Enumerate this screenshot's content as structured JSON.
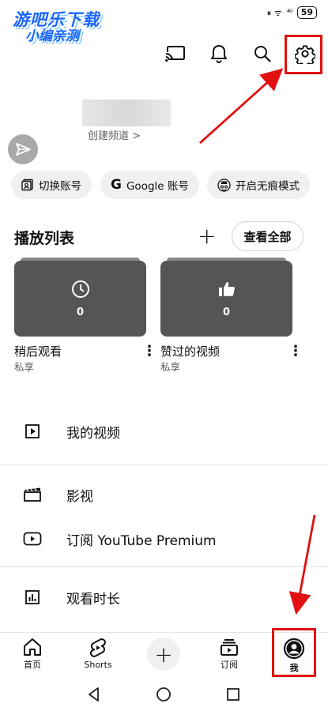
{
  "watermark": {
    "line1": "游吧乐下载",
    "line2": "小编亲测"
  },
  "status_bar": {
    "left_icons": "⏸ ᯤ",
    "signal": "⁴ᴳ",
    "battery": "59"
  },
  "profile": {
    "create_channel": "创建频道 >"
  },
  "chips": [
    {
      "label": "切换账号",
      "icon": "account-switch-icon"
    },
    {
      "label": "Google 账号",
      "icon": "google-icon"
    },
    {
      "label": "开启无痕模式",
      "icon": "incognito-icon"
    }
  ],
  "playlists": {
    "title": "播放列表",
    "view_all": "查看全部",
    "items": [
      {
        "title": "稍后观看",
        "subtitle": "私享",
        "count": "0",
        "icon": "clock-icon"
      },
      {
        "title": "赞过的视频",
        "subtitle": "私享",
        "count": "0",
        "icon": "thumbs-up-icon"
      }
    ]
  },
  "menu": [
    {
      "label": "我的视频",
      "icon": "play-box-icon"
    },
    {
      "label": "影视",
      "icon": "clapperboard-icon"
    },
    {
      "label": "订阅 YouTube Premium",
      "icon": "youtube-icon"
    },
    {
      "label": "观看时长",
      "icon": "bar-chart-icon"
    }
  ],
  "bottom_nav": {
    "home": "首页",
    "shorts": "Shorts",
    "subscriptions": "订阅",
    "me": "我"
  },
  "colors": {
    "highlight": "#e21010",
    "watermark": "#1a66ff",
    "thumb": "#555555"
  }
}
